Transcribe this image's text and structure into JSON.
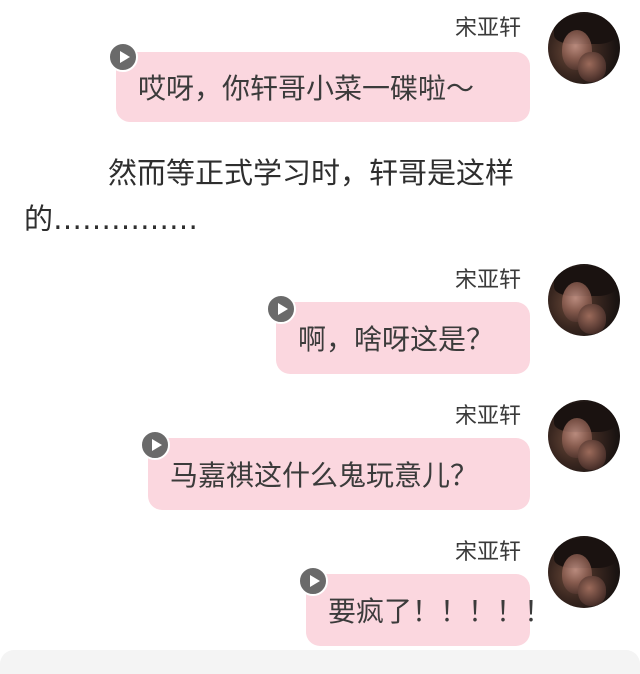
{
  "messages": [
    {
      "sender": "宋亚轩",
      "text": "哎呀，你轩哥小菜一碟啦～",
      "avatar_icon": "profile-photo"
    },
    {
      "sender": "宋亚轩",
      "text": "啊，啥呀这是？",
      "avatar_icon": "profile-photo"
    },
    {
      "sender": "宋亚轩",
      "text": "马嘉祺这什么鬼玩意儿？",
      "avatar_icon": "profile-photo"
    },
    {
      "sender": "宋亚轩",
      "text": "要疯了！！！！！",
      "avatar_icon": "profile-photo"
    }
  ],
  "narration": {
    "line1": "然而等正式学习时，轩哥是这样",
    "line2": "的……………"
  },
  "colors": {
    "bubble": "#fbd7df",
    "play_button": "#6a6a6a",
    "background": "#ffffff"
  },
  "icons": {
    "voice": "play-icon"
  }
}
